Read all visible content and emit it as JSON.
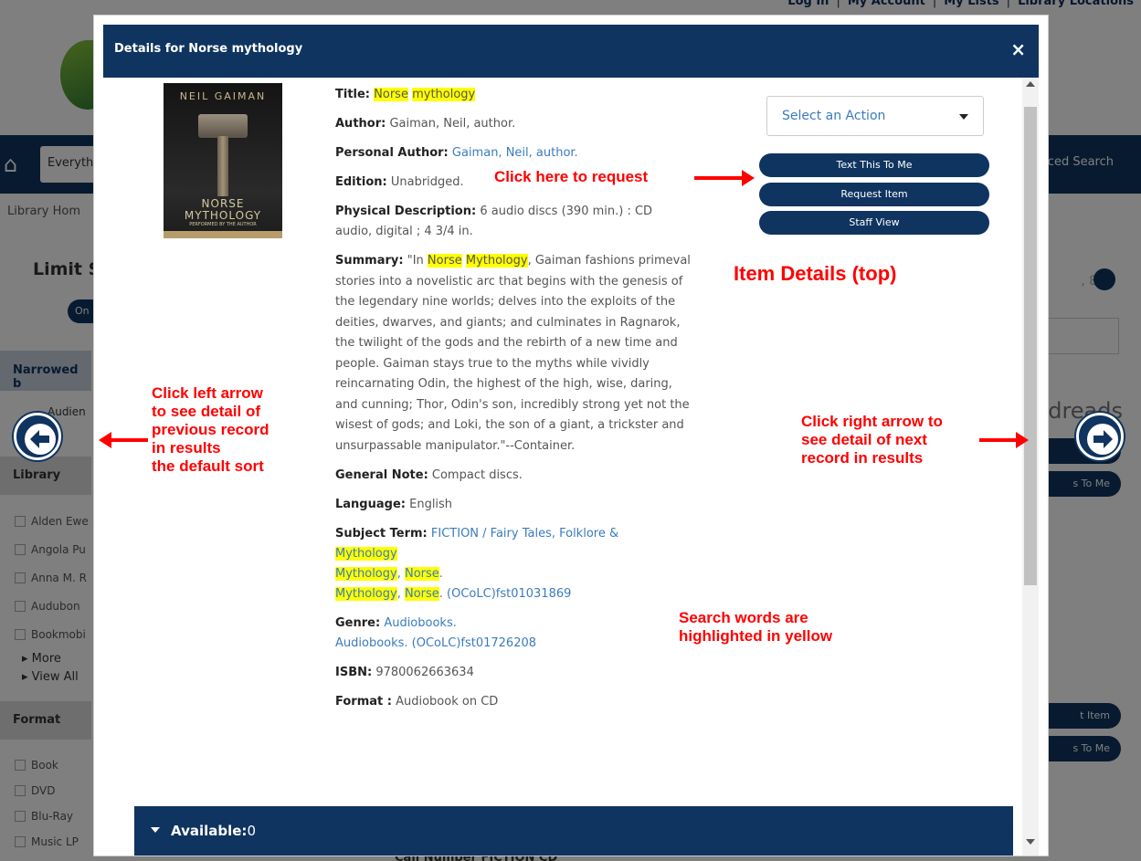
{
  "background": {
    "top_links": [
      "Log In",
      "My Account",
      "My Lists",
      "Library Locations"
    ],
    "search_scope": "Everyth",
    "advanced_search": "nced Search",
    "breadcrumb": "Library Hom",
    "limit_heading": "Limit S",
    "on_pill": "On",
    "narrowed_heading": "Narrowed b",
    "audience_item": "Audien",
    "library_heading": "Library",
    "library_items": [
      "Alden Ewe",
      "Angola Pu",
      "Anna M. R",
      "Audubon",
      "Bookmobi"
    ],
    "more_links": [
      "More",
      "View All"
    ],
    "format_heading": "Format",
    "format_items": [
      "Book",
      "DVD",
      "Blu-Ray",
      "Music LP"
    ],
    "pager_text": ", 8",
    "goodreads": "dreads",
    "right_buttons": [
      "t Item",
      "s To Me",
      "t Item",
      "s To Me"
    ],
    "call_number": "Call Number  FICTION CD"
  },
  "modal": {
    "title": "Details for Norse mythology",
    "close_label": "×",
    "cover": {
      "author": "NEIL GAIMAN",
      "title_line1": "NORSE",
      "title_line2": "MYTHOLOGY",
      "subtitle": "PERFORMED BY THE AUTHOR"
    },
    "fields": {
      "title_label": "Title:",
      "title_w1": "Norse",
      "title_w2": "mythology",
      "author_label": "Author:",
      "author_value": "Gaiman, Neil, author.",
      "personal_author_label": "Personal Author:",
      "personal_author_value": "Gaiman, Neil, author.",
      "edition_label": "Edition:",
      "edition_value": "Unabridged.",
      "physical_label": "Physical Description:",
      "physical_value": "6 audio discs (390 min.) : CD audio, digital ; 4 3/4 in.",
      "summary_label": "Summary:",
      "summary_pre": "\"In",
      "summary_hl1": "Norse",
      "summary_hl2": "Mythology",
      "summary_post": ", Gaiman fashions primeval stories into a novelistic arc that begins with the genesis of the legendary nine worlds; delves into the exploits of the deities, dwarves, and giants; and culminates in Ragnarok, the twilight of the gods and the rebirth of a new time and people. Gaiman stays true to the myths while vividly reincarnating Odin, the highest of the high, wise, daring, and cunning; Thor, Odin's son, incredibly strong yet not the wisest of gods; and Loki, the son of a giant, a trickster and unsurpassable manipulator.\"--Container.",
      "general_note_label": "General Note:",
      "general_note_value": "Compact discs.",
      "language_label": "Language:",
      "language_value": "English",
      "subject_label": "Subject Term:",
      "subject_1": "FICTION / Fairy Tales, Folklore &",
      "subject_1b": "Mythology",
      "subject_2a": "Mythology",
      "subject_2b": ", ",
      "subject_2c": "Norse",
      "subject_2d": ".",
      "subject_3a": "Mythology",
      "subject_3b": ", ",
      "subject_3c": "Norse",
      "subject_3d": ". (OCoLC)fst01031869",
      "genre_label": "Genre:",
      "genre_1": "Audiobooks.",
      "genre_2": "Audiobooks. (OCoLC)fst01726208",
      "isbn_label": "ISBN:",
      "isbn_value": "9780062663634",
      "format_label": "Format :",
      "format_value": "Audiobook on CD"
    },
    "action_select": "Select an Action",
    "buttons": {
      "text_to_me": "Text This To Me",
      "request_item": "Request Item",
      "staff_view": "Staff View"
    },
    "available_label": "Available:",
    "available_count": "0"
  },
  "annotations": {
    "request": "Click here to request",
    "item_details": "Item Details (top)",
    "left_arrow": [
      "Click left arrow",
      "to see detail of",
      "previous record",
      "in results",
      "the default sort"
    ],
    "right_arrow": [
      "Click right arrow to",
      "see detail of next",
      "record in results"
    ],
    "highlight": [
      "Search words are",
      "highlighted in yellow"
    ]
  },
  "colors": {
    "navy": "#0f3460",
    "highlight": "#ffff00",
    "annotation": "#ff0000",
    "link": "#3a7bbf"
  }
}
